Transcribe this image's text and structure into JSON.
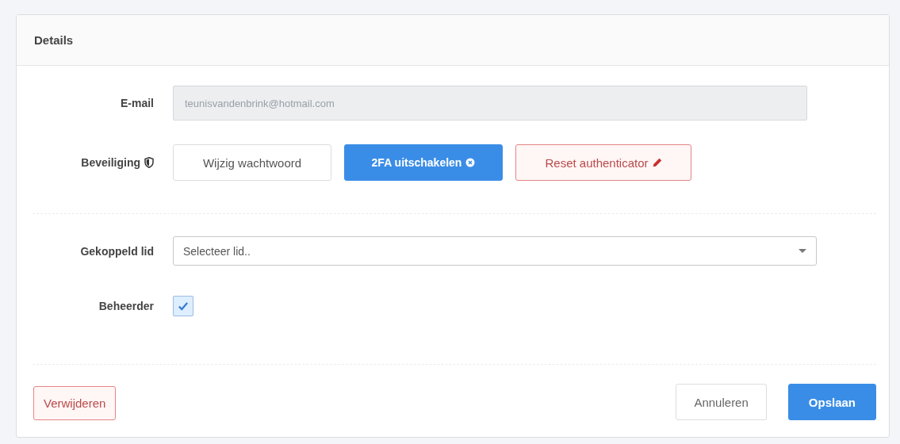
{
  "card": {
    "title": "Details"
  },
  "fields": [
    {
      "kind": "text",
      "label": "E-mail",
      "value": "teunisvandenbrink@hotmail.com",
      "disabled": true
    },
    {
      "kind": "buttons",
      "label": "Beveiliging",
      "buttons": [
        {
          "label": "Wijzig wachtwoord",
          "kind": "default"
        },
        {
          "label": "2FA uitschakelen",
          "kind": "primary"
        },
        {
          "label": "Reset authenticator",
          "kind": "danger"
        }
      ]
    },
    {
      "kind": "divider"
    },
    {
      "kind": "select",
      "label": "Gekoppeld lid",
      "placeholder": "Selecteer lid.."
    },
    {
      "kind": "checkbox",
      "label": "Beheerder",
      "checked": true
    }
  ],
  "footer": {
    "left": [
      {
        "label": "Verwijderen",
        "kind": "danger"
      }
    ],
    "right": [
      {
        "label": "Annuleren",
        "kind": "default"
      },
      {
        "label": "Opslaan",
        "kind": "primary"
      }
    ]
  }
}
